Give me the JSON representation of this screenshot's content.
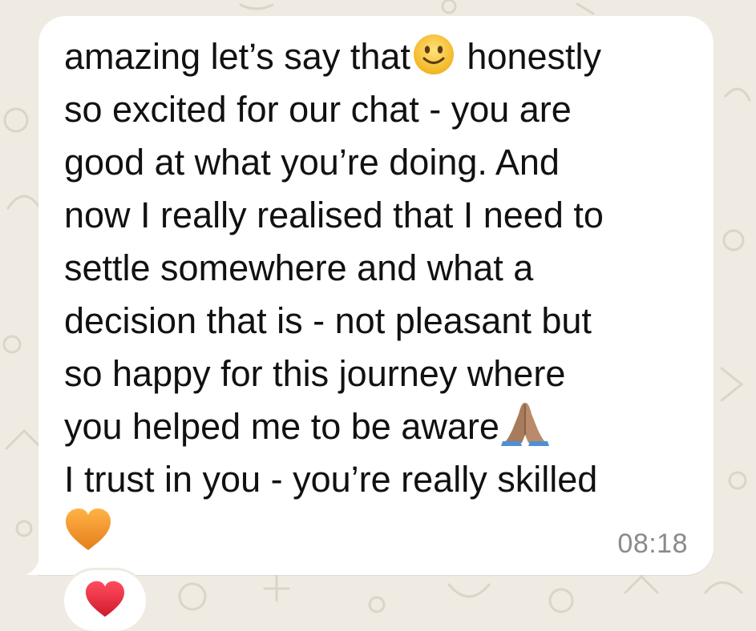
{
  "message": {
    "lines": [
      "amazing let’s say that",
      "honestly",
      "so excited for our chat - you are",
      "good at what you’re doing. And",
      "now I really realised that I need to",
      "settle somewhere and what a",
      "decision that is - not pleasant but",
      "so happy for this journey where",
      "you helped me to be aware",
      "I trust in you - you’re really skilled"
    ],
    "emojis": {
      "slight_smile": "slightly-smiling-face-icon",
      "praying_hands": "folded-hands-icon",
      "orange_heart": "orange-heart-icon"
    },
    "timestamp": "08:18"
  },
  "reaction": {
    "emoji": "red-heart-icon"
  },
  "colors": {
    "background": "#efeae2",
    "bubble": "#ffffff",
    "text": "#111111",
    "timestamp": "#8a8a8a",
    "smiley": "#f7c53b",
    "orange_heart": "#f5922b",
    "red_heart": "#e0263b",
    "hands": "#a77b5c"
  }
}
